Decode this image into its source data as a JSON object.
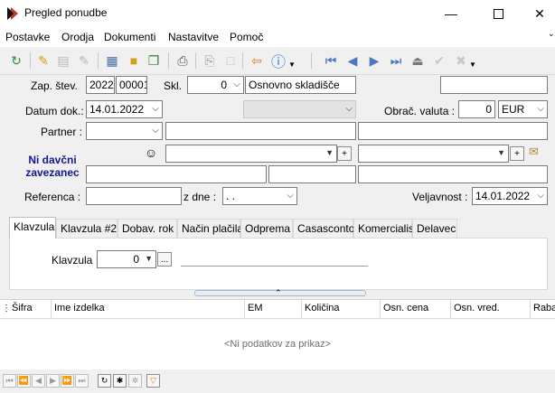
{
  "window": {
    "title": "Pregled ponudbe"
  },
  "menu": [
    "Postavke",
    "Orodja",
    "Dokumenti",
    "Nastavitve",
    "Pomoč"
  ],
  "header": {
    "zap_label": "Zap. štev.",
    "zap_year": "2022",
    "zap_number": "00001",
    "skl_label": "Skl.",
    "skl_value": "0",
    "skl_name": "Osnovno skladišče",
    "datum_label": "Datum dok.:",
    "datum_value": "14.01.2022",
    "obr_label": "Obrač. valuta :",
    "obr_value": "0",
    "currency": "EUR",
    "partner_label": "Partner :",
    "davcni_label": "Ni davčni zavezanec",
    "referenca_label": "Referenca :",
    "zdne_label": "z dne :",
    "zdne_value": ". .",
    "veljavnost_label": "Veljavnost :",
    "veljavnost_value": "14.01.2022"
  },
  "tabs": [
    "Klavzula",
    "Klavzula #2",
    "Dobav. rok",
    "Način plačila",
    "Odprema",
    "Casasconto",
    "Komercialist",
    "Delavec"
  ],
  "klavzula": {
    "label": "Klavzula :",
    "value": "0",
    "browse": "..."
  },
  "grid": {
    "columns": [
      "Šifra",
      "Ime izdelka",
      "EM",
      "Količina",
      "Osn. cena",
      "Osn. vred.",
      "Raba"
    ],
    "empty_text": "<Ni podatkov za prikaz>"
  },
  "colors": {
    "accent_blue": "#1f3c9e",
    "davcni_color": "#14188c"
  }
}
